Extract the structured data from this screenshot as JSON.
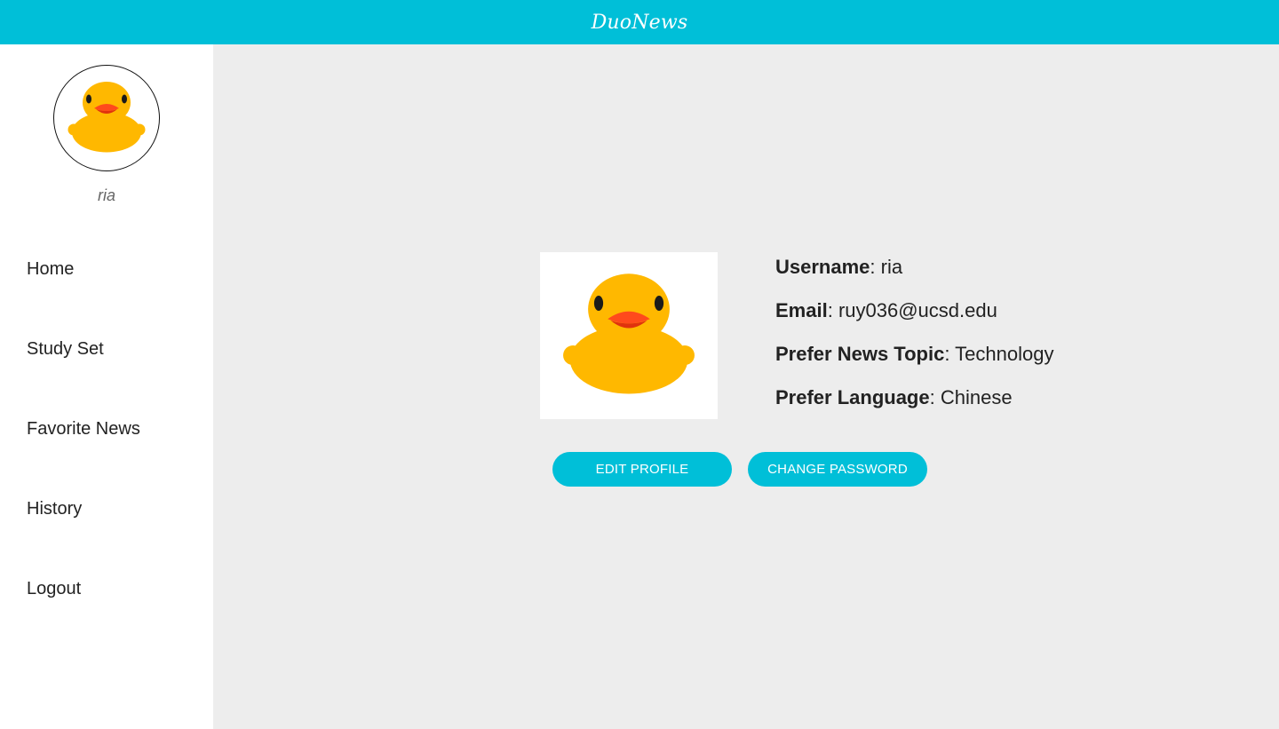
{
  "app": {
    "title": "DuoNews"
  },
  "sidebar": {
    "username": "ria",
    "avatar_icon": "rubber-duck-icon",
    "items": [
      {
        "label": "Home"
      },
      {
        "label": "Study Set"
      },
      {
        "label": "Favorite News"
      },
      {
        "label": "History"
      },
      {
        "label": "Logout"
      }
    ]
  },
  "profile": {
    "image_icon": "rubber-duck-icon",
    "fields": [
      {
        "label": "Username",
        "value": "ria"
      },
      {
        "label": "Email",
        "value": "ruy036@ucsd.edu"
      },
      {
        "label": "Prefer News Topic",
        "value": "Technology"
      },
      {
        "label": "Prefer Language",
        "value": "Chinese"
      }
    ],
    "separator": ": ",
    "edit_button": "EDIT PROFILE",
    "change_password_button": "CHANGE PASSWORD"
  },
  "colors": {
    "accent": "#00bfd8",
    "background": "#ededed",
    "duck_body": "#ffb800",
    "duck_beak": "#ff4a1c"
  }
}
